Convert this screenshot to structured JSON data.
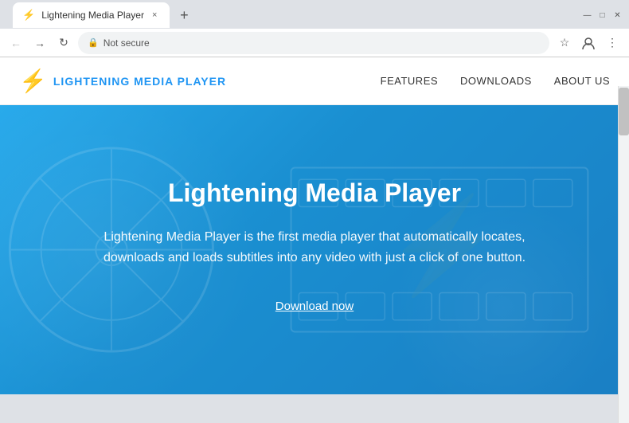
{
  "browser": {
    "title": "Lightening Media Player",
    "tab_favicon": "⚡",
    "tab_label": "Lightening Media Player",
    "tab_close": "×",
    "tab_new": "+",
    "window_minimize": "—",
    "window_maximize": "□",
    "window_close": "✕",
    "address_bar": {
      "lock_icon": "🔒",
      "url_text": "Not secure",
      "url_domain": ""
    }
  },
  "site": {
    "nav": {
      "logo_text": "LIGHTENING MEDIA PLAYER",
      "links": [
        {
          "label": "FEATURES",
          "id": "features"
        },
        {
          "label": "DOWNLOADS",
          "id": "downloads"
        },
        {
          "label": "ABOUT US",
          "id": "about-us"
        }
      ]
    },
    "hero": {
      "title": "Lightening Media Player",
      "description": "Lightening Media Player is the first media player that automatically locates, downloads and loads subtitles into any video with just a click of one button.",
      "cta": "Download now"
    }
  }
}
